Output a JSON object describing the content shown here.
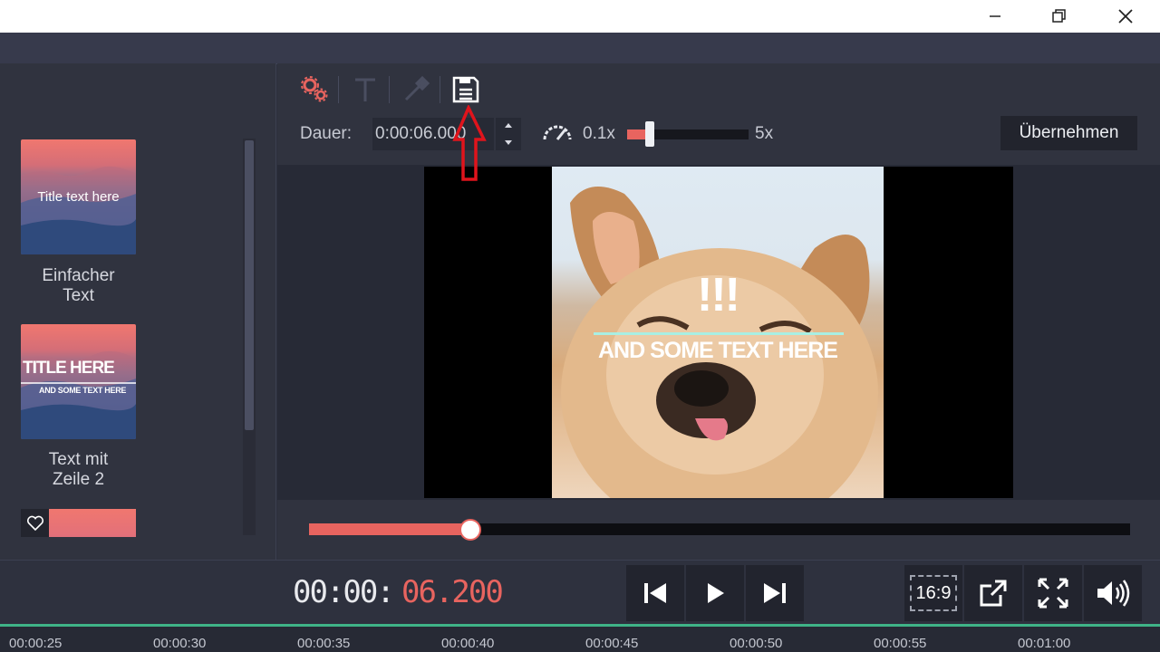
{
  "window": {
    "buttons": [
      "minimize-icon",
      "restore-icon",
      "close-icon"
    ]
  },
  "sidebar": {
    "presets": [
      {
        "preview_title": "Title text here",
        "caption_line1": "Einfacher",
        "caption_line2": "Text"
      },
      {
        "preview_title": "TITLE HERE",
        "preview_sub": "AND SOME TEXT HERE",
        "caption_line1": "Text mit",
        "caption_line2": "Zeile 2"
      }
    ],
    "partial_icon": "heart-icon"
  },
  "toolbar": {
    "tools": [
      "gears-icon",
      "text-icon",
      "eyedropper-icon",
      "save-icon"
    ],
    "duration_label": "Dauer:",
    "duration_value": "0:00:06.000",
    "speed_icon": "speedometer-icon",
    "speed_min": "0.1x",
    "speed_max": "5x",
    "speed_level": 0.19,
    "apply_label": "Übernehmen"
  },
  "preview": {
    "title": "!!!",
    "subtitle": "AND SOME TEXT HERE"
  },
  "player": {
    "time_main": "00:00:",
    "time_fraction": "06.200",
    "progress": 0.196,
    "aspect_label": "16:9",
    "buttons": [
      "skip-back-icon",
      "play-icon",
      "skip-forward-icon",
      "external-icon",
      "fullscreen-icon",
      "volume-icon"
    ]
  },
  "timeline": {
    "ticks": [
      "00:00:25",
      "00:00:30",
      "00:00:35",
      "00:00:40",
      "00:00:45",
      "00:00:50",
      "00:00:55",
      "00:01:00"
    ]
  },
  "colors": {
    "accent": "#e8645f",
    "timeline_line": "#3fb387",
    "annotation_arrow": "#e0141c"
  }
}
